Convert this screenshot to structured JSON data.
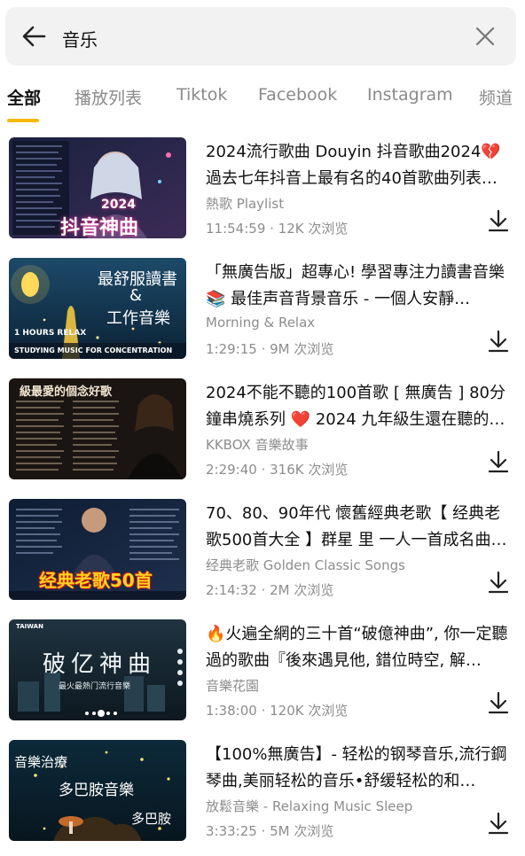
{
  "search": {
    "query": "音乐",
    "back_icon": "arrow-left-icon",
    "clear_icon": "close-icon"
  },
  "tabs": [
    {
      "label": "全部",
      "active": true
    },
    {
      "label": "播放列表",
      "active": false
    },
    {
      "label": "Tiktok",
      "active": false
    },
    {
      "label": "Facebook",
      "active": false
    },
    {
      "label": "Instagram",
      "active": false
    },
    {
      "label": "频道",
      "active": false
    }
  ],
  "colors": {
    "accent": "#f6b900",
    "muted_text": "#8d8d8d"
  },
  "results": [
    {
      "title": "2024流行歌曲 Douyin 抖音歌曲2024💔 過去七年抖音上最有名的40首歌曲列表…",
      "channel": "熱歌 Playlist",
      "meta": "11:54:59 · 12K 次浏览",
      "thumb_text": [
        "2024",
        "抖音神曲"
      ]
    },
    {
      "title": "「無廣告版」超專心! 學習專注力讀書音樂 📚 最佳声音背景音乐 - 一個人安靜…",
      "channel": "Morning & Relax",
      "meta": "1:29:15 · 9M 次浏览",
      "thumb_text": [
        "最舒服讀書",
        "&",
        "工作音樂",
        "1 HOURS RELAX",
        "STUDYING MUSIC FOR CONCENTRATION"
      ]
    },
    {
      "title": "2024不能不聽的100首歌 [ 無廣告 ] 80分鐘串燒系列 ❤️ 2024 九年級生還在聽的…",
      "channel": "KKBOX 音樂故事",
      "meta": "2:29:40 · 316K 次浏览",
      "thumb_text": [
        "級最愛的個念好歌"
      ]
    },
    {
      "title": "70、80、90年代 懷舊經典老歌【 经典老歌500首大全 】群星 里 一人一首成名曲…",
      "channel": "经典老歌 Golden Classic Songs",
      "meta": "2:14:32 · 2M 次浏览",
      "thumb_text": [
        "经典老歌50首"
      ]
    },
    {
      "title": "🔥火遍全網的三十首“破億神曲”, 你一定聽過的歌曲『後來遇見他, 錯位時空, 解…",
      "channel": "音樂花園",
      "meta": "1:38:00 · 120K 次浏览",
      "thumb_text": [
        "TAIWAN",
        "破亿神曲",
        "最火最熱门流行音樂"
      ]
    },
    {
      "title": "【100%無廣告】- 轻松的钢琴音乐,流行鋼琴曲,美丽轻松的音乐•舒缓轻松的和…",
      "channel": "放鬆音樂 - Relaxing Music Sleep",
      "meta": "3:33:25 · 5M 次浏览",
      "thumb_text": [
        "音樂治療",
        "多巴胺音樂",
        "多巴胺"
      ]
    }
  ]
}
